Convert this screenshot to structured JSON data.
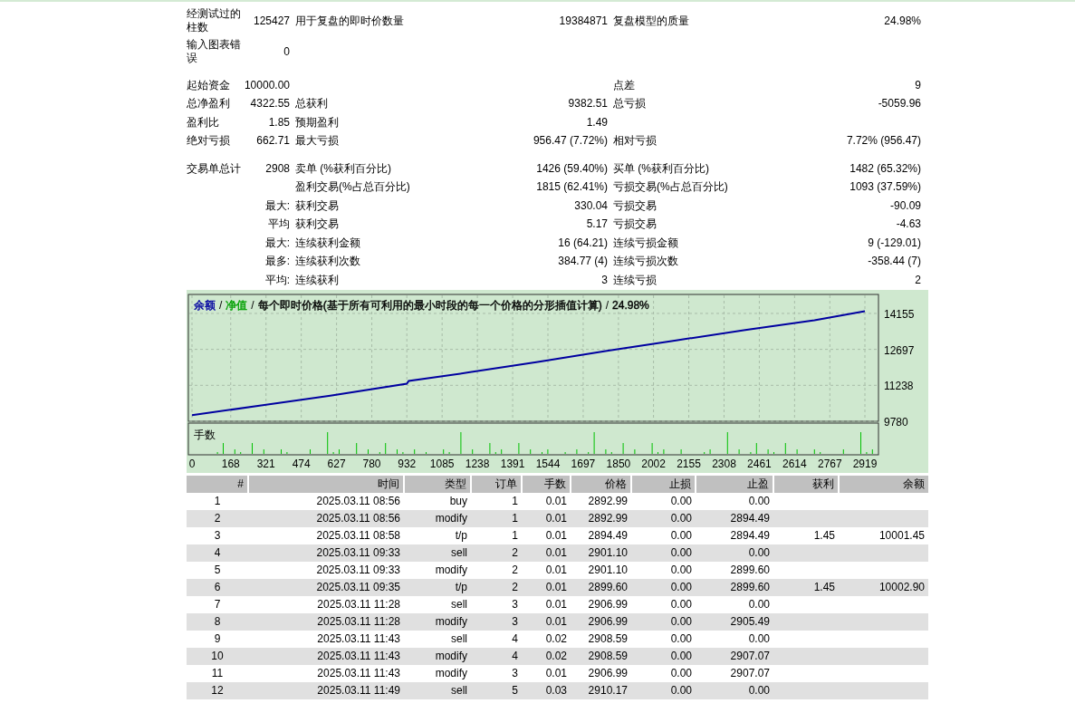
{
  "summary_groups": [
    {
      "rows": [
        {
          "label1": "经测试过的柱数",
          "value1": "125427",
          "label2": "用于复盘的即时价数量",
          "value2": "19384871",
          "label3": "复盘模型的质量",
          "value3": "24.98%"
        },
        {
          "label1": "输入图表错误",
          "value1": "0"
        }
      ]
    },
    {
      "rows": [
        {
          "label1": "起始资金",
          "value1": "10000.00",
          "label3": "点差",
          "value3": "9"
        },
        {
          "label1": "总净盈利",
          "value1": "4322.55",
          "label2": "总获利",
          "value2": "9382.51",
          "label3": "总亏损",
          "value3": "-5059.96"
        },
        {
          "label1": "盈利比",
          "value1": "1.85",
          "label2": "预期盈利",
          "value2": "1.49"
        },
        {
          "label1": "绝对亏损",
          "value1": "662.71",
          "label2": "最大亏损",
          "value2": "956.47 (7.72%)",
          "label3": "相对亏损",
          "value3": "7.72% (956.47)"
        }
      ]
    },
    {
      "rows": [
        {
          "label1": "交易单总计",
          "value1": "2908",
          "label2": "卖单 (%获利百分比)",
          "value2": "1426 (59.40%)",
          "label3": "买单 (%获利百分比)",
          "value3": "1482 (65.32%)"
        },
        {
          "label2": "盈利交易(%占总百分比)",
          "value2": "1815 (62.41%)",
          "label3": "亏损交易(%占总百分比)",
          "value3": "1093 (37.59%)"
        },
        {
          "value1": "最大:",
          "label2": "获利交易",
          "value2": "330.04",
          "label3": "亏损交易",
          "value3": "-90.09"
        },
        {
          "value1": "平均",
          "label2": "获利交易",
          "value2": "5.17",
          "label3": "亏损交易",
          "value3": "-4.63"
        },
        {
          "value1": "最大:",
          "label2": "连续获利金额",
          "value2": "16 (64.21)",
          "label3": "连续亏损金额",
          "value3": "9 (-129.01)"
        },
        {
          "value1": "最多:",
          "label2": "连续获利次数",
          "value2": "384.77 (4)",
          "label3": "连续亏损次数",
          "value3": "-358.44 (7)"
        },
        {
          "value1": "平均:",
          "label2": "连续获利",
          "value2": "3",
          "label3": "连续亏损",
          "value3": "2"
        }
      ]
    }
  ],
  "chart": {
    "legend_separator": "/",
    "legend": [
      {
        "text": "净值",
        "color": "#00a000"
      },
      {
        "text": "每个即时价格(基于所有可利用的最小时段的每一个价格的分形插值计算)",
        "color": "#000000"
      },
      {
        "text": "24.98%",
        "color": "#000000"
      }
    ],
    "volume_label": "手数",
    "chart_data": {
      "type": "line",
      "grid": true,
      "x": [
        0,
        300,
        600,
        932,
        940,
        1200,
        1500,
        1800,
        2100,
        2400,
        2700,
        2919
      ],
      "series": [
        {
          "name": "余额",
          "color": "#0000a0",
          "values": [
            10030,
            10420,
            10820,
            11300,
            11420,
            11760,
            12190,
            12640,
            13060,
            13480,
            13880,
            14240
          ]
        }
      ],
      "xlim": [
        0,
        2919
      ],
      "ylim": [
        9780,
        14925
      ],
      "xticks": [
        0,
        168,
        321,
        474,
        627,
        780,
        932,
        1085,
        1238,
        1391,
        1544,
        1697,
        1850,
        2002,
        2155,
        2308,
        2461,
        2614,
        2767,
        2919
      ],
      "yticks": [
        9780,
        11238,
        12697,
        14155
      ]
    }
  },
  "trades": {
    "columns": [
      "#",
      "时间",
      "类型",
      "订单",
      "手数",
      "价格",
      "止损",
      "止盈",
      "获利",
      "余额"
    ],
    "rows": [
      [
        "1",
        "2025.03.11 08:56",
        "buy",
        "1",
        "0.01",
        "2892.99",
        "0.00",
        "0.00"
      ],
      [
        "2",
        "2025.03.11 08:56",
        "modify",
        "1",
        "0.01",
        "2892.99",
        "0.00",
        "2894.49"
      ],
      [
        "3",
        "2025.03.11 08:58",
        "t/p",
        "1",
        "0.01",
        "2894.49",
        "0.00",
        "2894.49",
        "1.45",
        "10001.45"
      ],
      [
        "4",
        "2025.03.11 09:33",
        "sell",
        "2",
        "0.01",
        "2901.10",
        "0.00",
        "0.00"
      ],
      [
        "5",
        "2025.03.11 09:33",
        "modify",
        "2",
        "0.01",
        "2901.10",
        "0.00",
        "2899.60"
      ],
      [
        "6",
        "2025.03.11 09:35",
        "t/p",
        "2",
        "0.01",
        "2899.60",
        "0.00",
        "2899.60",
        "1.45",
        "10002.90"
      ],
      [
        "7",
        "2025.03.11 11:28",
        "sell",
        "3",
        "0.01",
        "2906.99",
        "0.00",
        "0.00"
      ],
      [
        "8",
        "2025.03.11 11:28",
        "modify",
        "3",
        "0.01",
        "2906.99",
        "0.00",
        "2905.49"
      ],
      [
        "9",
        "2025.03.11 11:43",
        "sell",
        "4",
        "0.02",
        "2908.59",
        "0.00",
        "0.00"
      ],
      [
        "10",
        "2025.03.11 11:43",
        "modify",
        "4",
        "0.02",
        "2908.59",
        "0.00",
        "2907.07"
      ],
      [
        "11",
        "2025.03.11 11:43",
        "modify",
        "3",
        "0.01",
        "2906.99",
        "0.00",
        "2907.07"
      ],
      [
        "12",
        "2025.03.11 11:49",
        "sell",
        "5",
        "0.03",
        "2910.17",
        "0.00",
        "0.00"
      ]
    ]
  }
}
